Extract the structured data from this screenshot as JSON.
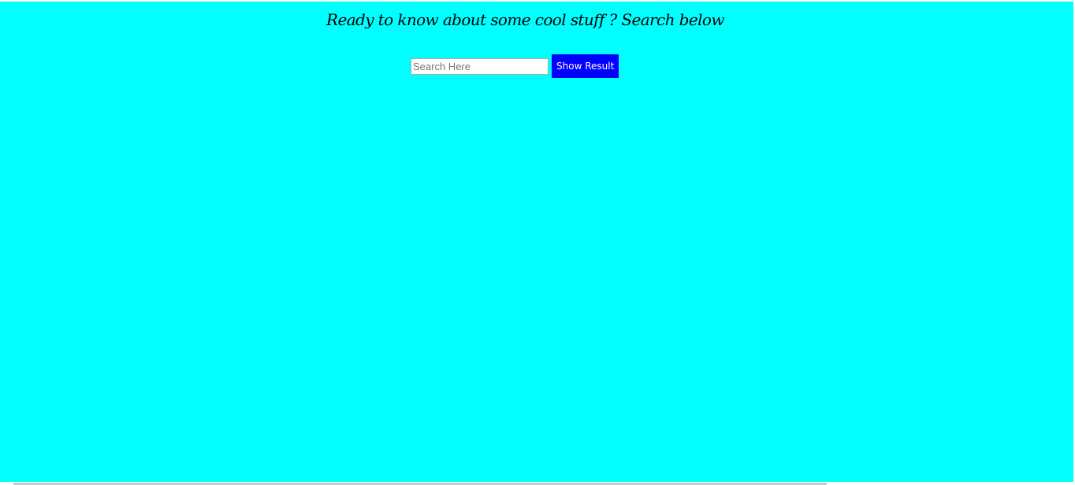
{
  "header": {
    "headline": "Ready to know about some cool stuff ? Search below"
  },
  "search": {
    "placeholder": "Search Here",
    "value": "",
    "button_label": "Show Result"
  },
  "colors": {
    "page_background": "#00ffff",
    "button_background": "#0000ff",
    "button_text": "#ffffff"
  }
}
